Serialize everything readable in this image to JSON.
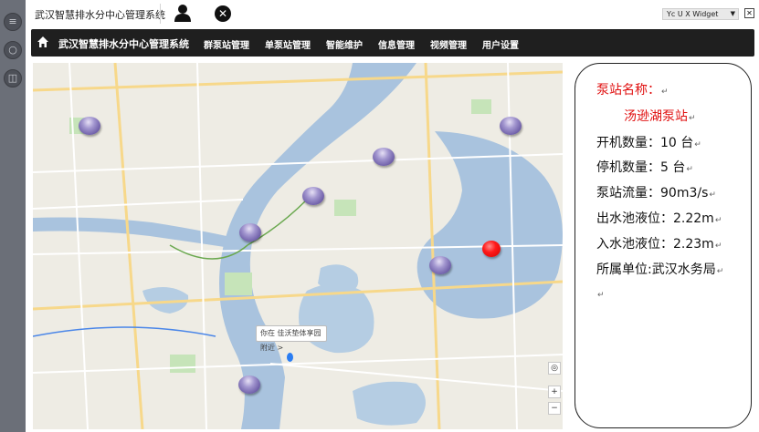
{
  "app": {
    "title": "武汉智慧排水分中心管理系统"
  },
  "widget": {
    "select_value": "Yc U X Widget",
    "close_label": "✕"
  },
  "navbar": {
    "title": "武汉智慧排水分中心管理系统",
    "items": [
      "群泵站管理",
      "单泵站管理",
      "智能维护",
      "信息管理",
      "视频管理",
      "用户设置"
    ]
  },
  "map": {
    "tooltip": "你在 佳沃垫体享园 附近 >"
  },
  "station": {
    "name_label": "泵站名称：",
    "name_value": "汤逊湖泵站",
    "running_label": "开机数量：",
    "running_value": "10 台",
    "stopped_label": "停机数量：",
    "stopped_value": "5 台",
    "flow_label": "泵站流量：",
    "flow_value": "90m3/s",
    "outlet_label": "出水池液位：",
    "outlet_value": "2.22m",
    "inlet_label": "入水池液位：",
    "inlet_value": "2.23m",
    "unit_label": "所属单位:",
    "unit_value": "武汉水务局",
    "paragraph_mark": "↵"
  },
  "colors": {
    "navbar_bg": "#1f1f1f",
    "accent_red": "#e01010",
    "marker_purple": "#7b6bb3",
    "marker_red": "#ff1a1a",
    "water": "#a9c3de"
  }
}
